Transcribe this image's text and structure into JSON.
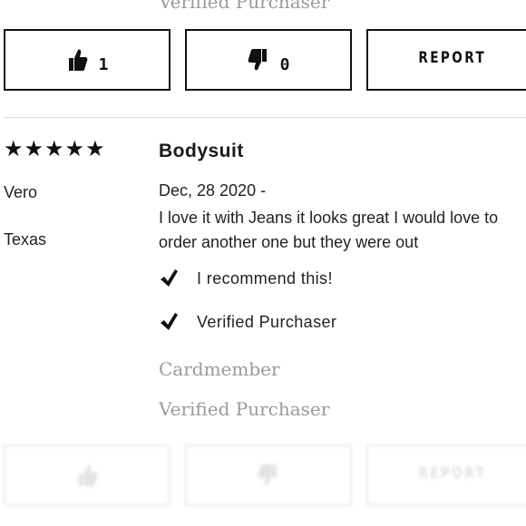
{
  "previous_review": {
    "badge_clipped": "Verified Purchaser",
    "helpful": {
      "thumbs_up_count": "1",
      "thumbs_down_count": "0",
      "report_label": "REPORT"
    }
  },
  "review": {
    "rating": 5,
    "stars_text": "★★★★★",
    "reviewer_name": "Vero",
    "reviewer_location": "Texas",
    "title": "Bodysuit",
    "date": "Dec, 28 2020 -",
    "body": "I love it with Jeans it looks great I would love to order another one but they were out",
    "recommend_label": "I recommend this!",
    "verified_label": "Verified Purchaser",
    "badges": [
      "Cardmember",
      "Verified Purchaser"
    ],
    "helpful": {
      "report_label": "REPORT"
    }
  },
  "icons": {
    "thumbs_up": "thumbs-up-icon",
    "thumbs_down": "thumbs-down-icon",
    "check": "check-icon"
  },
  "colors": {
    "text": "#222222",
    "border": "#111111",
    "badge_gray": "#9a9a9a",
    "divider": "#d9d9d9"
  }
}
